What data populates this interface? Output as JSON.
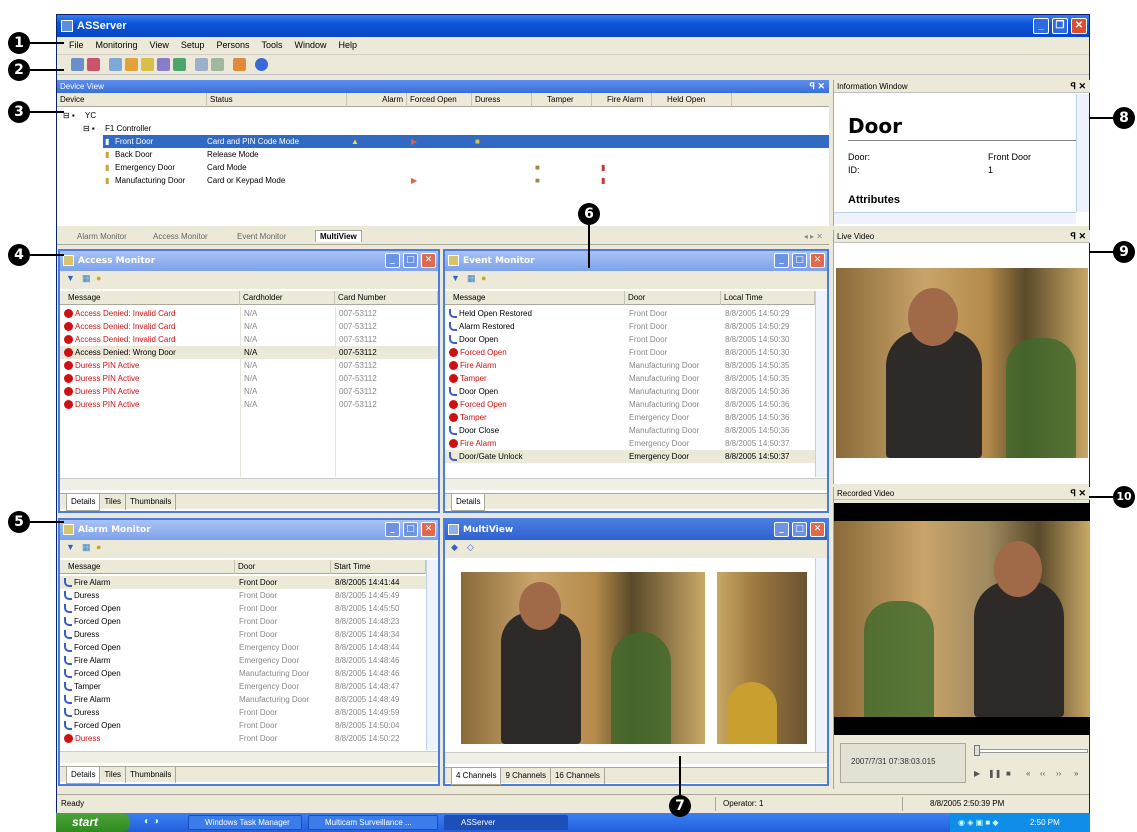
{
  "app": {
    "title": "ASServer"
  },
  "menu": [
    "File",
    "Monitoring",
    "View",
    "Setup",
    "Persons",
    "Tools",
    "Window",
    "Help"
  ],
  "callouts": [
    "1",
    "2",
    "3",
    "4",
    "5",
    "6",
    "7",
    "8",
    "9",
    "10"
  ],
  "device_view": {
    "title": "Device View",
    "columns": [
      "Device",
      "Status",
      "Alarm",
      "Forced Open",
      "Duress",
      "Tamper",
      "Fire Alarm",
      "Held Open"
    ],
    "tree": {
      "root": "YC",
      "controller": "F1 Controller"
    },
    "rows": [
      {
        "device": "Front Door",
        "status": "Card and PIN Code Mode"
      },
      {
        "device": "Back Door",
        "status": "Release Mode"
      },
      {
        "device": "Emergency Door",
        "status": "Card Mode"
      },
      {
        "device": "Manufacturing Door",
        "status": "Card or Keypad Mode"
      }
    ]
  },
  "info_window": {
    "title": "Information Window",
    "heading": "Door",
    "fields": [
      {
        "label": "Door:",
        "value": "Front Door"
      },
      {
        "label": "ID:",
        "value": "1"
      }
    ],
    "section": "Attributes"
  },
  "doc_tabs": [
    "Alarm Monitor",
    "Access Monitor",
    "Event Monitor",
    "MultiView"
  ],
  "access_monitor": {
    "title": "Access Monitor",
    "columns": [
      "Message",
      "Cardholder",
      "Card Number"
    ],
    "rows": [
      {
        "message": "Access Denied: Invalid Card",
        "cardholder": "N/A",
        "card": "007-53112"
      },
      {
        "message": "Access Denied: Invalid Card",
        "cardholder": "N/A",
        "card": "007-53112"
      },
      {
        "message": "Access Denied: Invalid Card",
        "cardholder": "N/A",
        "card": "007-53112"
      },
      {
        "message": "Access Denied: Wrong Door",
        "cardholder": "N/A",
        "card": "007-53112"
      },
      {
        "message": "Duress PIN Active",
        "cardholder": "N/A",
        "card": "007-53112"
      },
      {
        "message": "Duress PIN Active",
        "cardholder": "N/A",
        "card": "007-53112"
      },
      {
        "message": "Duress PIN Active",
        "cardholder": "N/A",
        "card": "007-53112"
      },
      {
        "message": "Duress PIN Active",
        "cardholder": "N/A",
        "card": "007-53112"
      }
    ],
    "tabs": [
      "Details",
      "Tiles",
      "Thumbnails"
    ]
  },
  "event_monitor": {
    "title": "Event Monitor",
    "columns": [
      "Message",
      "Door",
      "Local Time"
    ],
    "rows": [
      {
        "message": "Held Open Restored",
        "door": "Front Door",
        "time": "8/8/2005 14:50:29",
        "red": false
      },
      {
        "message": "Alarm Restored",
        "door": "Front Door",
        "time": "8/8/2005 14:50:29",
        "red": false
      },
      {
        "message": "Door Open",
        "door": "Front Door",
        "time": "8/8/2005 14:50:30",
        "red": false
      },
      {
        "message": "Forced Open",
        "door": "Front Door",
        "time": "8/8/2005 14:50:30",
        "red": true
      },
      {
        "message": "Fire Alarm",
        "door": "Manufacturing Door",
        "time": "8/8/2005 14:50:35",
        "red": true
      },
      {
        "message": "Tamper",
        "door": "Manufacturing Door",
        "time": "8/8/2005 14:50:35",
        "red": true
      },
      {
        "message": "Door Open",
        "door": "Manufacturing Door",
        "time": "8/8/2005 14:50:36",
        "red": false
      },
      {
        "message": "Forced Open",
        "door": "Manufacturing Door",
        "time": "8/8/2005 14:50:36",
        "red": true
      },
      {
        "message": "Tamper",
        "door": "Emergency Door",
        "time": "8/8/2005 14:50:36",
        "red": true
      },
      {
        "message": "Door Close",
        "door": "Manufacturing Door",
        "time": "8/8/2005 14:50:36",
        "red": false
      },
      {
        "message": "Fire Alarm",
        "door": "Emergency Door",
        "time": "8/8/2005 14:50:37",
        "red": true
      },
      {
        "message": "Door/Gate Unlock",
        "door": "Emergency Door",
        "time": "8/8/2005 14:50:37",
        "red": false
      }
    ],
    "tabs": [
      "Details"
    ]
  },
  "alarm_monitor": {
    "title": "Alarm Monitor",
    "columns": [
      "Message",
      "Door",
      "Start Time"
    ],
    "rows": [
      {
        "message": "Fire Alarm",
        "door": "Front Door",
        "time": "8/8/2005 14:41:44"
      },
      {
        "message": "Duress",
        "door": "Front Door",
        "time": "8/8/2005 14:45:49"
      },
      {
        "message": "Forced Open",
        "door": "Front Door",
        "time": "8/8/2005 14:45:50"
      },
      {
        "message": "Forced Open",
        "door": "Front Door",
        "time": "8/8/2005 14:48:23"
      },
      {
        "message": "Duress",
        "door": "Front Door",
        "time": "8/8/2005 14:48:34"
      },
      {
        "message": "Forced Open",
        "door": "Emergency Door",
        "time": "8/8/2005 14:48:44"
      },
      {
        "message": "Fire Alarm",
        "door": "Emergency Door",
        "time": "8/8/2005 14:48:46"
      },
      {
        "message": "Forced Open",
        "door": "Manufacturing Door",
        "time": "8/8/2005 14:48:46"
      },
      {
        "message": "Tamper",
        "door": "Emergency Door",
        "time": "8/8/2005 14:48:47"
      },
      {
        "message": "Fire Alarm",
        "door": "Manufacturing Door",
        "time": "8/8/2005 14:48:49"
      },
      {
        "message": "Duress",
        "door": "Front Door",
        "time": "8/8/2005 14:49:59"
      },
      {
        "message": "Forced Open",
        "door": "Front Door",
        "time": "8/8/2005 14:50:04"
      },
      {
        "message": "Duress",
        "door": "Front Door",
        "time": "8/8/2005 14:50:22"
      }
    ],
    "tabs": [
      "Details",
      "Tiles",
      "Thumbnails"
    ]
  },
  "multiview": {
    "title": "MultiView",
    "tabs": [
      "4 Channels",
      "9 Channels",
      "16 Channels"
    ]
  },
  "live_video": {
    "title": "Live Video"
  },
  "recorded_video": {
    "title": "Recorded Video",
    "timestamp": "2007/7/31 07:38:03.015"
  },
  "statusbar": {
    "left": "Ready",
    "operator": "Operator: 1",
    "datetime": "8/8/2005 2:50:39 PM"
  },
  "taskbar": {
    "start": "start",
    "tasks": [
      "Windows Task Manager",
      "Multicam Surveillance ...",
      "ASServer"
    ],
    "clock": "2:50 PM"
  }
}
